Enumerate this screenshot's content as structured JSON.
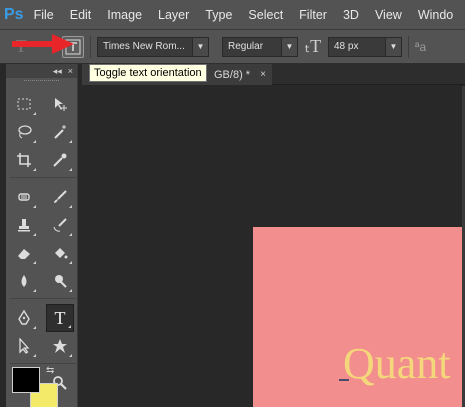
{
  "app": {
    "logo": "Ps"
  },
  "menu": [
    "File",
    "Edit",
    "Image",
    "Layer",
    "Type",
    "Select",
    "Filter",
    "3D",
    "View",
    "Windo"
  ],
  "options": {
    "tool_glyph": "T",
    "font_family": "Times New Rom...",
    "font_style": "Regular",
    "font_size": "48 px",
    "antialias_label": "ªa"
  },
  "tooltip": "Toggle text orientation",
  "tab": {
    "label": "GB/8) *",
    "close": "×"
  },
  "toolbox": {
    "collapse": "◂◂",
    "close": "×",
    "swap": "⇆"
  },
  "canvas": {
    "text": "Quant"
  },
  "colors": {
    "foreground": "#000000",
    "background": "#f4ea6a",
    "canvas": "#f28f8e",
    "text": "#f5d77b",
    "arrow": "#e8262a"
  },
  "icons": [
    "text-tool-icon",
    "toggle-orientation-icon",
    "font-size-icon",
    "antialias-icon"
  ]
}
